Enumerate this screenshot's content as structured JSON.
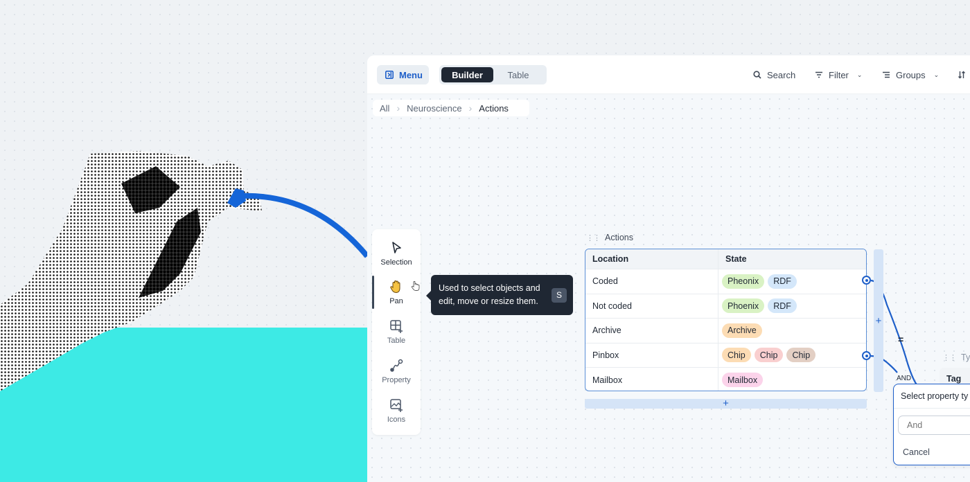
{
  "toolbar": {
    "menu_label": "Menu",
    "view_tabs": [
      {
        "label": "Builder",
        "active": true
      },
      {
        "label": "Table",
        "active": false
      }
    ],
    "search_label": "Search",
    "filter_label": "Filter",
    "groups_label": "Groups"
  },
  "breadcrumb": {
    "items": [
      "All",
      "Neuroscience",
      "Actions"
    ]
  },
  "palette": {
    "tools": [
      {
        "label": "Selection",
        "icon": "cursor-arrow-icon"
      },
      {
        "label": "Pan",
        "icon": "hand-icon",
        "active": true
      },
      {
        "label": "Table",
        "icon": "table-add-icon"
      },
      {
        "label": "Property",
        "icon": "connector-icon"
      },
      {
        "label": "Icons",
        "icon": "image-add-icon"
      }
    ]
  },
  "tooltip": {
    "text_line1": "Used to select objects and",
    "text_line2": "edit, move or resize them.",
    "shortcut": "S"
  },
  "table_node": {
    "title": "Actions",
    "columns": [
      "Location",
      "State"
    ],
    "rows": [
      {
        "location": "Coded",
        "chips": [
          {
            "label": "Pheonix",
            "color": "#d9f2c4"
          },
          {
            "label": "RDF",
            "color": "#d4e7fa"
          }
        ]
      },
      {
        "location": "Not coded",
        "chips": [
          {
            "label": "Phoenix",
            "color": "#d9f2c4"
          },
          {
            "label": "RDF",
            "color": "#d4e7fa"
          }
        ]
      },
      {
        "location": "Archive",
        "chips": [
          {
            "label": "Archive",
            "color": "#fcdcb4"
          }
        ]
      },
      {
        "location": "Pinbox",
        "chips": [
          {
            "label": "Chip",
            "color": "#fcdcb4"
          },
          {
            "label": "Chip",
            "color": "#f9cfcf"
          },
          {
            "label": "Chip",
            "color": "#e3cfc4"
          }
        ]
      },
      {
        "location": "Mailbox",
        "chips": [
          {
            "label": "Mailbox",
            "color": "#fbd3ea"
          }
        ]
      }
    ],
    "add_row_label": "+",
    "add_col_label": "+"
  },
  "connectors": {
    "equals_label": "=",
    "and_label": "AND"
  },
  "type_node": {
    "title": "Typ",
    "column": "Tag"
  },
  "property_popup": {
    "title": "Select property ty",
    "input_placeholder": "And",
    "cancel_label": "Cancel"
  },
  "colors": {
    "accent": "#1e5fc9",
    "teal": "#3deae5",
    "dark": "#1f2733"
  }
}
